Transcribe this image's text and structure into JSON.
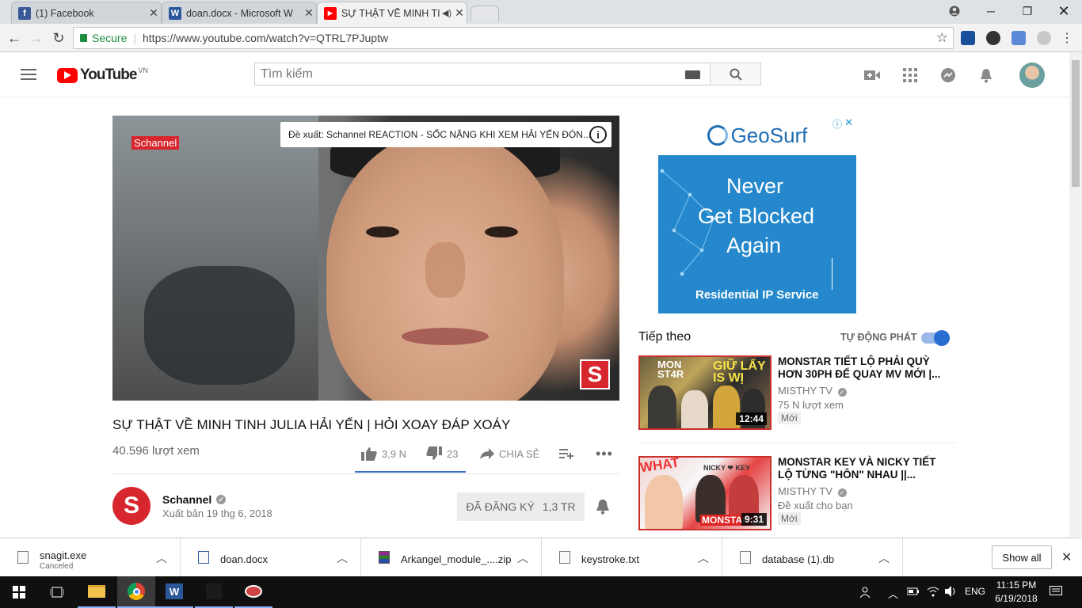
{
  "browser": {
    "tabs": [
      {
        "title": "(1) Facebook",
        "color": "#3b5998",
        "glyph": "f"
      },
      {
        "title": "doan.docx - Microsoft W",
        "color": "#2b579a",
        "glyph": "W"
      },
      {
        "title": "SỰ THẬT VỀ MINH TI",
        "color": "#ff0000",
        "glyph": "▶"
      }
    ],
    "secure_label": "Secure",
    "url": "https://www.youtube.com/watch?v=QTRL7PJuptw"
  },
  "youtube": {
    "logo_text": "YouTube",
    "region": "VN",
    "search_placeholder": "Tìm kiếm",
    "player": {
      "suggestion": "Đề xuất: Schannel REACTION - SỐC NẶNG KHI XEM HẢI YẾN ĐÓN...",
      "channel_tag": "Schannel",
      "logo_glyph": "S"
    },
    "video": {
      "title": "SỰ THẬT VỀ MINH TINH JULIA HẢI YẾN | HỎI XOAY ĐÁP XOÁY",
      "views": "40.596 lượt xem",
      "likes": "3,9 N",
      "dislikes": "23",
      "share_label": "CHIA SẺ"
    },
    "channel": {
      "name": "Schannel",
      "published": "Xuất bản 19 thg 6, 2018",
      "subscribe_label": "ĐÃ ĐĂNG KÝ",
      "subscriber_count": "1,3 TR"
    },
    "ad": {
      "brand": "GeoSurf",
      "line1": "Never",
      "line2": "Get Blocked",
      "line3": "Again",
      "footer": "Residential IP Service"
    },
    "up_next_label": "Tiếp theo",
    "autoplay_label": "TỰ ĐỘNG PHÁT",
    "autoplay_on": true,
    "recommendations": [
      {
        "title": "MONSTAR TIẾT LỘ PHẢI QUỲ HƠN 30PH ĐỂ QUAY MV MỚI |...",
        "channel": "MISTHY TV",
        "meta": "75 N lượt xem",
        "badge": "Mới",
        "duration": "12:44"
      },
      {
        "title": "MONSTAR KEY VÀ NICKY TIẾT LỘ TỪNG \"HÔN\" NHAU ||...",
        "channel": "MISTHY TV",
        "meta": "Đề xuất cho bạn",
        "badge": "Mới",
        "duration": "9:31"
      }
    ]
  },
  "downloads": {
    "items": [
      {
        "name": "snagit.exe",
        "status": "Canceled"
      },
      {
        "name": "doan.docx",
        "status": ""
      },
      {
        "name": "Arkangel_module_....zip",
        "status": ""
      },
      {
        "name": "keystroke.txt",
        "status": ""
      },
      {
        "name": "database (1).db",
        "status": ""
      }
    ],
    "show_all_label": "Show all"
  },
  "taskbar": {
    "language": "ENG",
    "time": "11:15 PM",
    "date": "6/19/2018"
  }
}
